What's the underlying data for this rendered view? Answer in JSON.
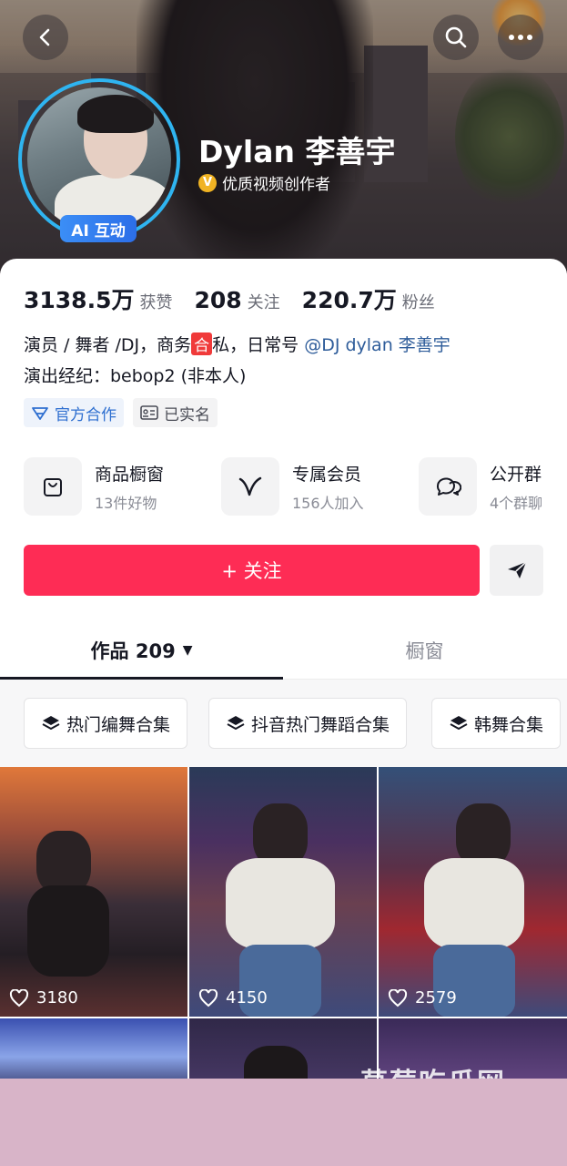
{
  "header": {
    "profile_name": "Dylan 李善宇",
    "verification_label": "优质视频创作者",
    "ai_badge_label": "AI 互动"
  },
  "stats": [
    {
      "value": "3138.5万",
      "label": "获赞"
    },
    {
      "value": "208",
      "label": "关注"
    },
    {
      "value": "220.7万",
      "label": "粉丝"
    }
  ],
  "bio": {
    "line1_prefix": "演员 / 舞者 /DJ，商务",
    "line1_badge": "合",
    "line1_mid": "私，日常号 ",
    "line1_mention": "@DJ dylan 李善宇",
    "line2": "演出经纪：bebop2 (非本人)"
  },
  "tags": [
    {
      "label": "官方合作",
      "icon": "official-cooperation-icon"
    },
    {
      "label": "已实名",
      "icon": "id-card-icon"
    }
  ],
  "features": [
    {
      "title": "商品橱窗",
      "subtitle": "13件好物",
      "icon": "shopping-bag-icon"
    },
    {
      "title": "专属会员",
      "subtitle": "156人加入",
      "icon": "member-v-icon"
    },
    {
      "title": "公开群",
      "subtitle": "4个群聊",
      "icon": "group-chat-icon"
    }
  ],
  "actions": {
    "follow_label": "+ 关注"
  },
  "tabs": [
    {
      "label": "作品 209",
      "active": true
    },
    {
      "label": "橱窗",
      "active": false
    }
  ],
  "collections": [
    {
      "label": "热门编舞合集"
    },
    {
      "label": "抖音热门舞蹈合集"
    },
    {
      "label": "韩舞合集"
    }
  ],
  "videos": [
    {
      "likes": "3180"
    },
    {
      "likes": "4150"
    },
    {
      "likes": "2579"
    }
  ],
  "watermark": "草莓吃瓜网",
  "colors": {
    "accent": "#fe2c55",
    "avatar_ring": "#2fb4f0",
    "ai_badge": "#2c6ee8",
    "verify_badge": "#f0b323",
    "mention": "#2e5c9a",
    "bottom_bar": "#d8b4c8"
  }
}
